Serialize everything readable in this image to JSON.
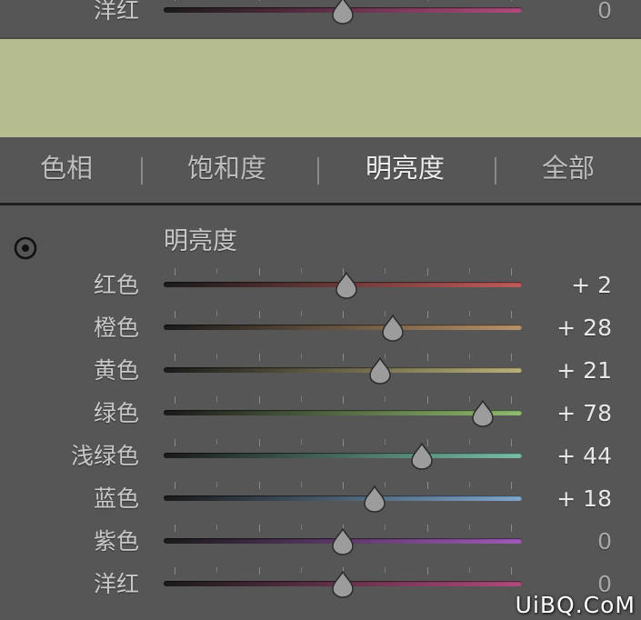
{
  "top_panel": {
    "row": {
      "label": "洋红",
      "value": "0",
      "level": 0,
      "colors": [
        "#1a1a1a",
        "#b04a7c"
      ]
    }
  },
  "tabs": [
    {
      "label": "色相",
      "active": false
    },
    {
      "label": "饱和度",
      "active": false
    },
    {
      "label": "明亮度",
      "active": true
    },
    {
      "label": "全部",
      "active": false
    }
  ],
  "section": {
    "icon": "target-adjust-icon",
    "heading": "明亮度"
  },
  "sliders": [
    {
      "label": "红色",
      "value": "+ 2",
      "level": 2,
      "colors": [
        "#1a1a1a",
        "#c05a5a"
      ]
    },
    {
      "label": "橙色",
      "value": "+ 28",
      "level": 28,
      "colors": [
        "#1a1a1a",
        "#b8926a"
      ]
    },
    {
      "label": "黄色",
      "value": "+ 21",
      "level": 21,
      "colors": [
        "#1a1a1a",
        "#b9b07a"
      ]
    },
    {
      "label": "绿色",
      "value": "+ 78",
      "level": 78,
      "colors": [
        "#1a1a1a",
        "#8fbb6e"
      ]
    },
    {
      "label": "浅绿色",
      "value": "+ 44",
      "level": 44,
      "colors": [
        "#1a1a1a",
        "#78bda8"
      ]
    },
    {
      "label": "蓝色",
      "value": "+ 18",
      "level": 18,
      "colors": [
        "#1a1a1a",
        "#7ea6cc"
      ]
    },
    {
      "label": "紫色",
      "value": "0",
      "level": 0,
      "colors": [
        "#1a1a1a",
        "#a05ab8"
      ]
    },
    {
      "label": "洋红",
      "value": "0",
      "level": 0,
      "colors": [
        "#1a1a1a",
        "#b04a7c"
      ]
    }
  ],
  "slider_range": [
    -100,
    100
  ],
  "watermark": "UiBQ.CoM",
  "colors": {
    "panel_bg": "#565656",
    "page_bg": "#b4bc90",
    "thumb": "#9c9c9c"
  }
}
